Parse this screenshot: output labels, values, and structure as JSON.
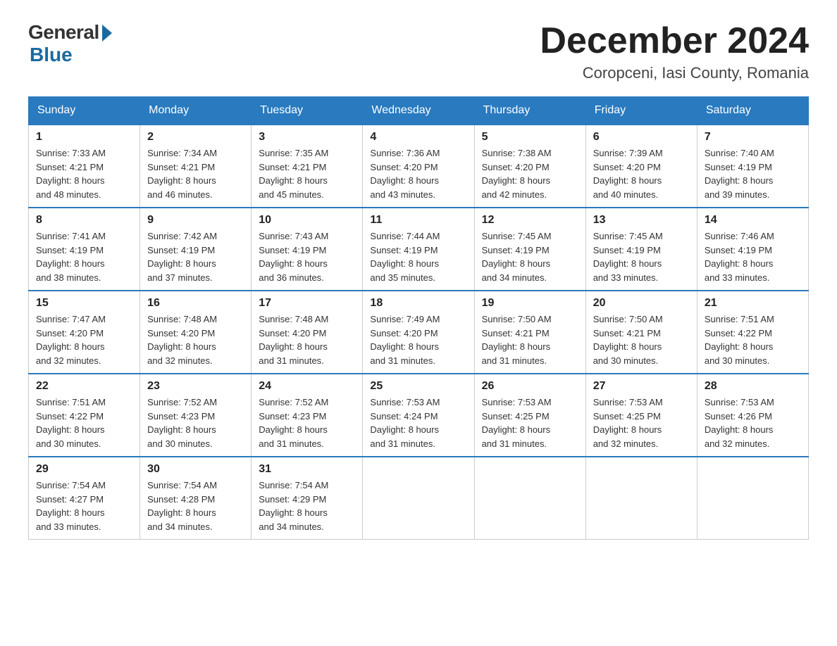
{
  "logo": {
    "general": "General",
    "blue": "Blue",
    "subtitle": "Blue"
  },
  "header": {
    "month_title": "December 2024",
    "location": "Coropceni, Iasi County, Romania"
  },
  "days_of_week": [
    "Sunday",
    "Monday",
    "Tuesday",
    "Wednesday",
    "Thursday",
    "Friday",
    "Saturday"
  ],
  "weeks": [
    [
      {
        "day": "1",
        "sunrise": "7:33 AM",
        "sunset": "4:21 PM",
        "daylight": "8 hours and 48 minutes."
      },
      {
        "day": "2",
        "sunrise": "7:34 AM",
        "sunset": "4:21 PM",
        "daylight": "8 hours and 46 minutes."
      },
      {
        "day": "3",
        "sunrise": "7:35 AM",
        "sunset": "4:21 PM",
        "daylight": "8 hours and 45 minutes."
      },
      {
        "day": "4",
        "sunrise": "7:36 AM",
        "sunset": "4:20 PM",
        "daylight": "8 hours and 43 minutes."
      },
      {
        "day": "5",
        "sunrise": "7:38 AM",
        "sunset": "4:20 PM",
        "daylight": "8 hours and 42 minutes."
      },
      {
        "day": "6",
        "sunrise": "7:39 AM",
        "sunset": "4:20 PM",
        "daylight": "8 hours and 40 minutes."
      },
      {
        "day": "7",
        "sunrise": "7:40 AM",
        "sunset": "4:19 PM",
        "daylight": "8 hours and 39 minutes."
      }
    ],
    [
      {
        "day": "8",
        "sunrise": "7:41 AM",
        "sunset": "4:19 PM",
        "daylight": "8 hours and 38 minutes."
      },
      {
        "day": "9",
        "sunrise": "7:42 AM",
        "sunset": "4:19 PM",
        "daylight": "8 hours and 37 minutes."
      },
      {
        "day": "10",
        "sunrise": "7:43 AM",
        "sunset": "4:19 PM",
        "daylight": "8 hours and 36 minutes."
      },
      {
        "day": "11",
        "sunrise": "7:44 AM",
        "sunset": "4:19 PM",
        "daylight": "8 hours and 35 minutes."
      },
      {
        "day": "12",
        "sunrise": "7:45 AM",
        "sunset": "4:19 PM",
        "daylight": "8 hours and 34 minutes."
      },
      {
        "day": "13",
        "sunrise": "7:45 AM",
        "sunset": "4:19 PM",
        "daylight": "8 hours and 33 minutes."
      },
      {
        "day": "14",
        "sunrise": "7:46 AM",
        "sunset": "4:19 PM",
        "daylight": "8 hours and 33 minutes."
      }
    ],
    [
      {
        "day": "15",
        "sunrise": "7:47 AM",
        "sunset": "4:20 PM",
        "daylight": "8 hours and 32 minutes."
      },
      {
        "day": "16",
        "sunrise": "7:48 AM",
        "sunset": "4:20 PM",
        "daylight": "8 hours and 32 minutes."
      },
      {
        "day": "17",
        "sunrise": "7:48 AM",
        "sunset": "4:20 PM",
        "daylight": "8 hours and 31 minutes."
      },
      {
        "day": "18",
        "sunrise": "7:49 AM",
        "sunset": "4:20 PM",
        "daylight": "8 hours and 31 minutes."
      },
      {
        "day": "19",
        "sunrise": "7:50 AM",
        "sunset": "4:21 PM",
        "daylight": "8 hours and 31 minutes."
      },
      {
        "day": "20",
        "sunrise": "7:50 AM",
        "sunset": "4:21 PM",
        "daylight": "8 hours and 30 minutes."
      },
      {
        "day": "21",
        "sunrise": "7:51 AM",
        "sunset": "4:22 PM",
        "daylight": "8 hours and 30 minutes."
      }
    ],
    [
      {
        "day": "22",
        "sunrise": "7:51 AM",
        "sunset": "4:22 PM",
        "daylight": "8 hours and 30 minutes."
      },
      {
        "day": "23",
        "sunrise": "7:52 AM",
        "sunset": "4:23 PM",
        "daylight": "8 hours and 30 minutes."
      },
      {
        "day": "24",
        "sunrise": "7:52 AM",
        "sunset": "4:23 PM",
        "daylight": "8 hours and 31 minutes."
      },
      {
        "day": "25",
        "sunrise": "7:53 AM",
        "sunset": "4:24 PM",
        "daylight": "8 hours and 31 minutes."
      },
      {
        "day": "26",
        "sunrise": "7:53 AM",
        "sunset": "4:25 PM",
        "daylight": "8 hours and 31 minutes."
      },
      {
        "day": "27",
        "sunrise": "7:53 AM",
        "sunset": "4:25 PM",
        "daylight": "8 hours and 32 minutes."
      },
      {
        "day": "28",
        "sunrise": "7:53 AM",
        "sunset": "4:26 PM",
        "daylight": "8 hours and 32 minutes."
      }
    ],
    [
      {
        "day": "29",
        "sunrise": "7:54 AM",
        "sunset": "4:27 PM",
        "daylight": "8 hours and 33 minutes."
      },
      {
        "day": "30",
        "sunrise": "7:54 AM",
        "sunset": "4:28 PM",
        "daylight": "8 hours and 34 minutes."
      },
      {
        "day": "31",
        "sunrise": "7:54 AM",
        "sunset": "4:29 PM",
        "daylight": "8 hours and 34 minutes."
      },
      null,
      null,
      null,
      null
    ]
  ],
  "labels": {
    "sunrise": "Sunrise:",
    "sunset": "Sunset:",
    "daylight": "Daylight:"
  }
}
